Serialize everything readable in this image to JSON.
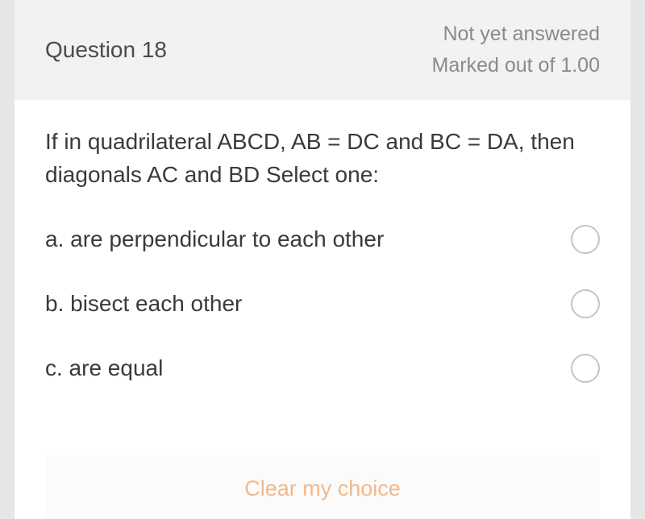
{
  "header": {
    "question_title": "Question 18",
    "status": "Not yet answered",
    "marks": "Marked out of 1.00"
  },
  "question": {
    "text": "If in quadrilateral ABCD, AB = DC and BC = DA, then diagonals AC and BD Select one:"
  },
  "options": [
    {
      "label": "a. are perpendicular to each other"
    },
    {
      "label": "b. bisect each other"
    },
    {
      "label": "c. are equal"
    }
  ],
  "actions": {
    "clear": "Clear my choice"
  }
}
